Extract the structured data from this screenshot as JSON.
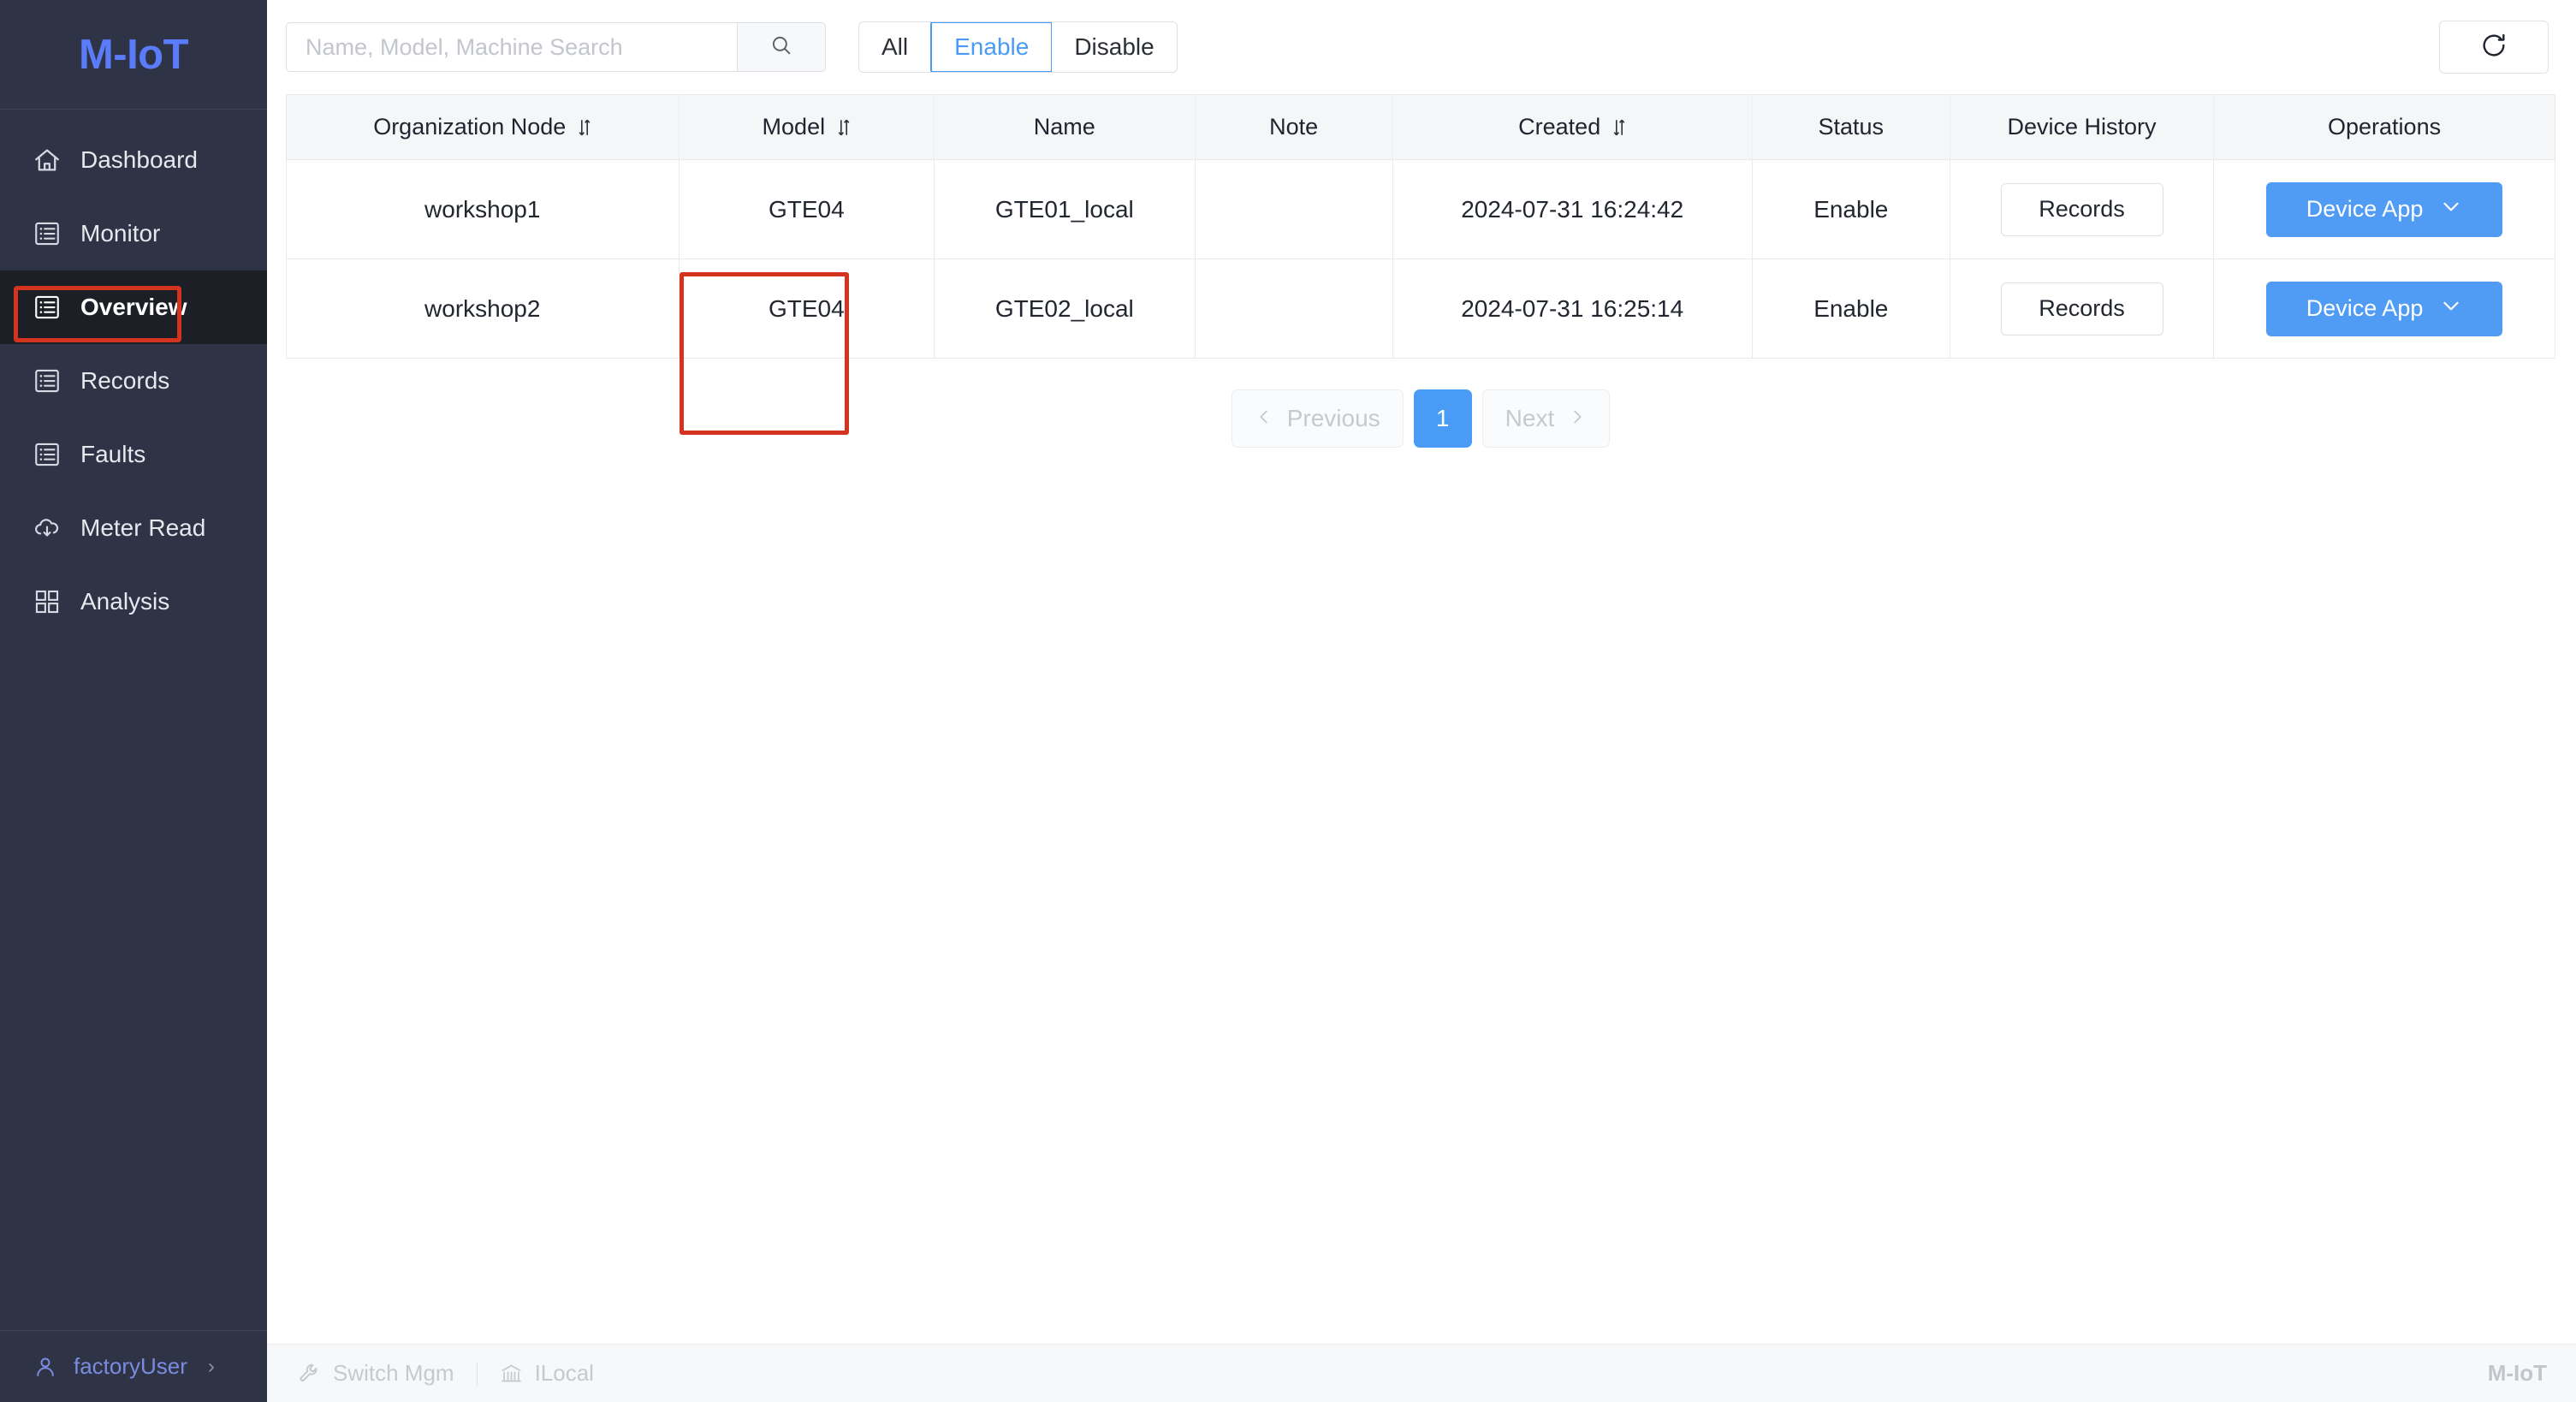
{
  "brand": {
    "name": "M-IoT"
  },
  "sidebar": {
    "items": [
      {
        "label": "Dashboard",
        "icon": "home-icon",
        "active": false
      },
      {
        "label": "Monitor",
        "icon": "list-box-icon",
        "active": false
      },
      {
        "label": "Overview",
        "icon": "list-box-icon",
        "active": true
      },
      {
        "label": "Records",
        "icon": "list-box-icon",
        "active": false
      },
      {
        "label": "Faults",
        "icon": "list-box-icon",
        "active": false
      },
      {
        "label": "Meter Read",
        "icon": "cloud-download-icon",
        "active": false
      },
      {
        "label": "Analysis",
        "icon": "grid-icon",
        "active": false
      }
    ],
    "user": {
      "name": "factoryUser",
      "icon": "user-icon",
      "chevron": "›"
    }
  },
  "toolbar": {
    "search_placeholder": "Name, Model, Machine Search",
    "search_value": "",
    "search_button_icon": "search-icon",
    "filters": [
      {
        "label": "All",
        "active": false
      },
      {
        "label": "Enable",
        "active": true
      },
      {
        "label": "Disable",
        "active": false
      }
    ],
    "refresh_icon": "refresh-icon"
  },
  "table": {
    "columns": [
      {
        "label": "Organization Node",
        "sortable": true
      },
      {
        "label": "Model",
        "sortable": true
      },
      {
        "label": "Name",
        "sortable": false
      },
      {
        "label": "Note",
        "sortable": false
      },
      {
        "label": "Created",
        "sortable": true
      },
      {
        "label": "Status",
        "sortable": false
      },
      {
        "label": "Device History",
        "sortable": false
      },
      {
        "label": "Operations",
        "sortable": false
      }
    ],
    "rows": [
      {
        "organization_node": "workshop1",
        "model": "GTE04",
        "name": "GTE01_local",
        "note": "",
        "created": "2024-07-31 16:24:42",
        "status": "Enable",
        "device_history_label": "Records",
        "operations_label": "Device App"
      },
      {
        "organization_node": "workshop2",
        "model": "GTE04",
        "name": "GTE02_local",
        "note": "",
        "created": "2024-07-31 16:25:14",
        "status": "Enable",
        "device_history_label": "Records",
        "operations_label": "Device App"
      }
    ]
  },
  "pagination": {
    "previous_label": "Previous",
    "next_label": "Next",
    "current_page": "1"
  },
  "statusbar": {
    "switch_mgm_label": "Switch Mgm",
    "local_label": "ILocal",
    "right_label": "M-IoT"
  },
  "colors": {
    "brand_blue": "#5b7cfa",
    "accent_blue": "#4a9bf5",
    "button_blue": "#509bf3",
    "sidebar_bg": "#2e3345",
    "sidebar_active_bg": "#1d1f27",
    "annotation_red": "#d4341f"
  }
}
